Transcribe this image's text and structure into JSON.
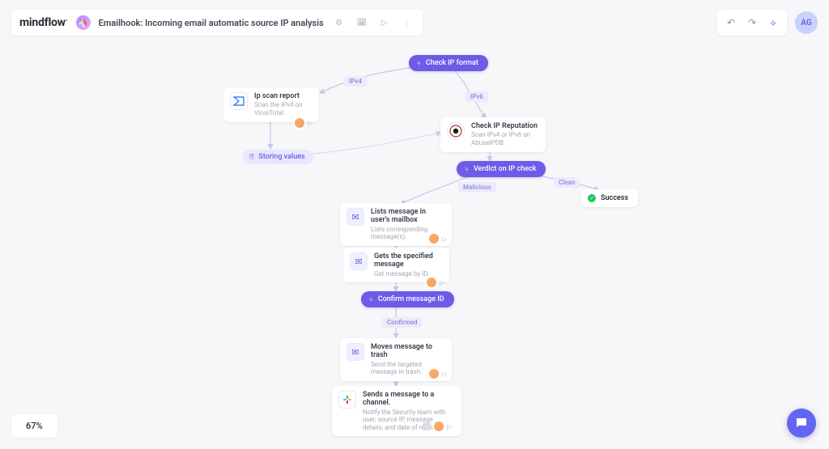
{
  "header": {
    "brand": "mindflow",
    "flow_emoji": "🦄",
    "title": "Emailhook: Incoming email automatic source IP analysis"
  },
  "toolbar": {
    "undo": "↶",
    "redo": "↷",
    "magic": "⟡",
    "avatar_initials": "AG"
  },
  "zoom": "67%",
  "labels": {
    "ipv4": "IPv4",
    "ipv6": "IPv6",
    "malicious": "Malicious",
    "clean": "Clean",
    "confirmed": "Confirmed"
  },
  "nodes": {
    "check_ip_format": {
      "label": "Check IP format"
    },
    "ip_scan_report": {
      "title": "Ip scan report",
      "subtitle": "Scan the IPv4 on VirusTotal."
    },
    "storing_values": {
      "label": "Storing values"
    },
    "check_ip_reputation": {
      "title": "Check IP Reputation",
      "subtitle": "Scan IPv4 or IPv6 on AbuseIPDB."
    },
    "verdict": {
      "label": "Verdict on IP check"
    },
    "success": {
      "label": "Success"
    },
    "lists_messages": {
      "title": "Lists message in user's mailbox",
      "subtitle": "Lists corresponding message(s)."
    },
    "gets_message": {
      "title": "Gets the specified message",
      "subtitle": "Get message by ID."
    },
    "confirm_id": {
      "label": "Confirm message ID"
    },
    "moves_trash": {
      "title": "Moves message to trash",
      "subtitle": "Send the targeted message in trash."
    },
    "slack": {
      "title": "Sends a message to a channel.",
      "subtitle": "Notify the Security team with user, source IP, message details, and date of receipt."
    }
  }
}
